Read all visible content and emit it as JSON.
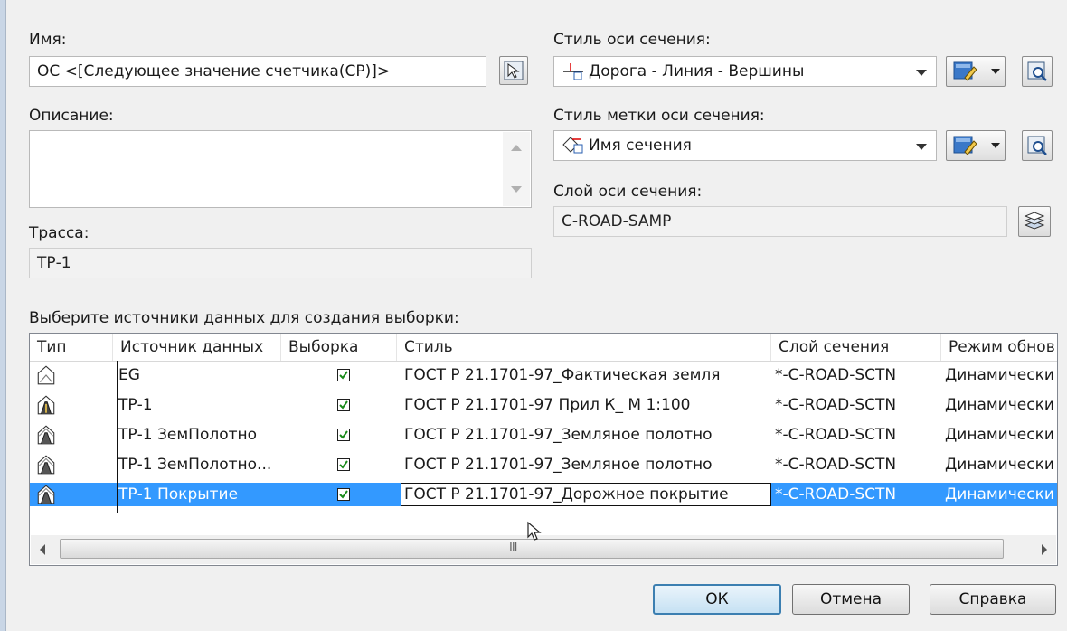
{
  "name": {
    "label": "Имя:",
    "value": "ОС <[Следующее значение счетчика(СР)]>"
  },
  "description": {
    "label": "Описание:",
    "value": ""
  },
  "alignment": {
    "label": "Трасса:",
    "value": "ТР-1"
  },
  "section_line_style": {
    "label": "Стиль оси сечения:",
    "value": "Дорога - Линия - Вершины"
  },
  "section_label_style": {
    "label": "Стиль метки оси сечения:",
    "value": "Имя сечения"
  },
  "section_layer": {
    "label": "Слой оси сечения:",
    "value": "C-ROAD-SAMP"
  },
  "sources": {
    "label": "Выберите источники данных для создания выборки:",
    "columns": [
      "Тип",
      "Источник данных",
      "Выборка",
      "Стиль",
      "Слой сечения",
      "Режим обнов"
    ],
    "rows": [
      {
        "source": "EG",
        "sample": true,
        "style": "ГОСТ Р 21.1701-97_Фактическая земля",
        "layer": "*-C-ROAD-SCTN",
        "mode": "Динамически",
        "icon": "surface-icon",
        "selected": false
      },
      {
        "source": "ТР-1",
        "sample": true,
        "style": "ГОСТ Р 21.1701-97 Прил К_ М 1:100",
        "layer": "*-C-ROAD-SCTN",
        "mode": "Динамически",
        "icon": "corridor-icon",
        "selected": false
      },
      {
        "source": "ТР-1 ЗемПолотно",
        "sample": true,
        "style": "ГОСТ Р 21.1701-97_Земляное полотно",
        "layer": "*-C-ROAD-SCTN",
        "mode": "Динамически",
        "icon": "corridor-surface-icon",
        "selected": false
      },
      {
        "source": "ТР-1 ЗемПолотно...",
        "sample": true,
        "style": "ГОСТ Р 21.1701-97_Земляное полотно",
        "layer": "*-C-ROAD-SCTN",
        "mode": "Динамически",
        "icon": "corridor-surface-icon",
        "selected": false
      },
      {
        "source": "ТР-1 Покрытие",
        "sample": true,
        "style": "ГОСТ Р 21.1701-97_Дорожное покрытие",
        "layer": "*-C-ROAD-SCTN",
        "mode": "Динамически",
        "icon": "corridor-surface-icon",
        "selected": true
      }
    ],
    "scroll_grip": "III"
  },
  "buttons": {
    "ok": "ОК",
    "cancel": "Отмена",
    "help": "Справка"
  },
  "colors": {
    "selection": "#3399ff",
    "background": "#f0f0f0",
    "default_button_border": "#3c7fb1"
  }
}
